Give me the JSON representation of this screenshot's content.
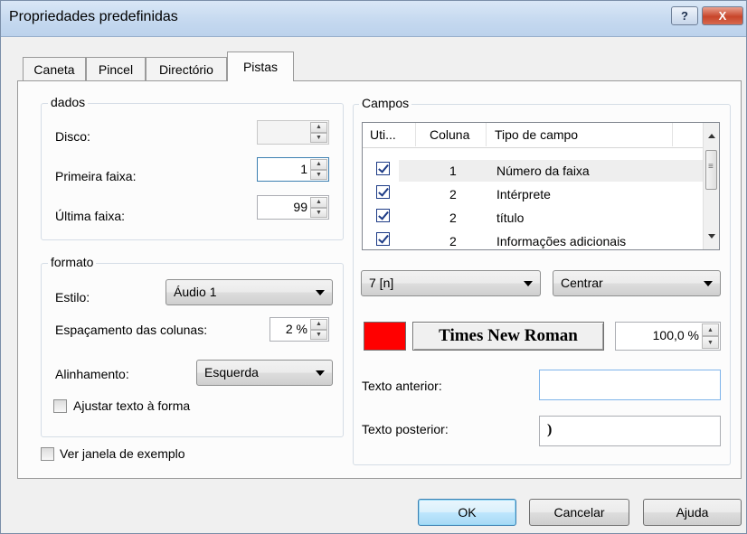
{
  "window": {
    "title": "Propriedades predefinidas",
    "help_label": "?",
    "close_label": "X"
  },
  "tabs": [
    {
      "label": "Caneta",
      "active": false
    },
    {
      "label": "Pincel",
      "active": false
    },
    {
      "label": "Directório",
      "active": false
    },
    {
      "label": "Pistas",
      "active": true
    }
  ],
  "dados": {
    "group_label": "dados",
    "disco_label": "Disco:",
    "disco_value": "",
    "primeira_label": "Primeira faixa:",
    "primeira_value": "1",
    "ultima_label": "Última faixa:",
    "ultima_value": "99"
  },
  "formato": {
    "group_label": "formato",
    "estilo_label": "Estilo:",
    "estilo_value": "Áudio 1",
    "espacamento_label": "Espaçamento das colunas:",
    "espacamento_value": "2 %",
    "alinhamento_label": "Alinhamento:",
    "alinhamento_value": "Esquerda",
    "ajustar_label": "Ajustar texto à forma",
    "ajustar_checked": false
  },
  "ver_exemplo": {
    "label": "Ver janela de exemplo",
    "checked": false
  },
  "campos": {
    "group_label": "Campos",
    "columns": [
      "Uti...",
      "Coluna",
      "Tipo de campo"
    ],
    "rows": [
      {
        "checked": true,
        "coluna": "1",
        "tipo": "Número da faixa"
      },
      {
        "checked": true,
        "coluna": "2",
        "tipo": "Intérprete"
      },
      {
        "checked": true,
        "coluna": "2",
        "tipo": "título"
      },
      {
        "checked": true,
        "coluna": "2",
        "tipo": "Informações adicionais"
      }
    ],
    "column_select_value": "7 [n]",
    "align_select_value": "Centrar",
    "color": "#ff0000",
    "font_label": "Times New Roman",
    "font_size_value": "100,0 %",
    "texto_anterior_label": "Texto anterior:",
    "texto_anterior_value": "",
    "texto_posterior_label": "Texto posterior:",
    "texto_posterior_value": ")"
  },
  "buttons": {
    "ok": "OK",
    "cancel": "Cancelar",
    "help": "Ajuda"
  }
}
